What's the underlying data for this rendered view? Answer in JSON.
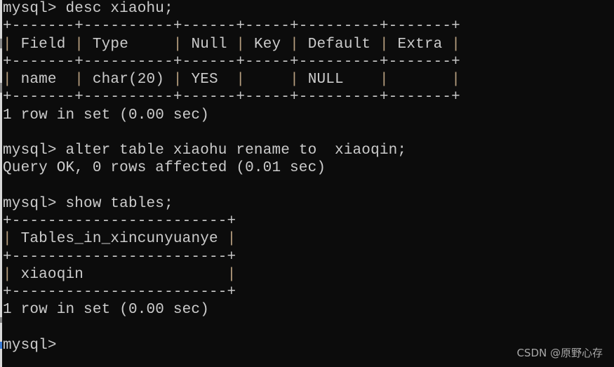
{
  "window": {
    "type": "MySQL command-line console",
    "background_color": "#0c0c0c",
    "text_color": "#cccccc"
  },
  "session": [
    {
      "kind": "command",
      "prompt": "mysql>",
      "text": "desc xiaohu;"
    },
    {
      "kind": "table",
      "columns": [
        "Field",
        "Type",
        "Null",
        "Key",
        "Default",
        "Extra"
      ],
      "rows": [
        [
          "name",
          "char(20)",
          "YES",
          "",
          "NULL",
          ""
        ]
      ]
    },
    {
      "kind": "output",
      "text": "1 row in set (0.00 sec)"
    },
    {
      "kind": "blank"
    },
    {
      "kind": "command",
      "prompt": "mysql>",
      "text": "alter table xiaohu rename to  xiaoqin;"
    },
    {
      "kind": "output",
      "text": "Query OK, 0 rows affected (0.01 sec)"
    },
    {
      "kind": "blank"
    },
    {
      "kind": "command",
      "prompt": "mysql>",
      "text": "show tables;"
    },
    {
      "kind": "table",
      "columns": [
        "Tables_in_xincunyuanye"
      ],
      "rows": [
        [
          "xiaoqin"
        ]
      ]
    },
    {
      "kind": "output",
      "text": "1 row in set (0.00 sec)"
    },
    {
      "kind": "blank"
    },
    {
      "kind": "command",
      "prompt": "mysql>",
      "text": ""
    }
  ],
  "watermark": "CSDN @原野心存"
}
